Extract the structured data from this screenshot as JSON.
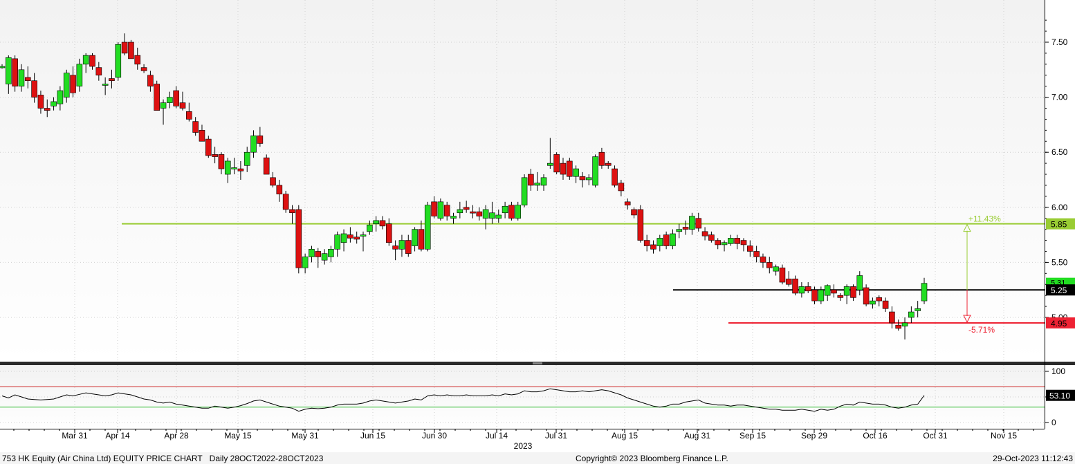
{
  "colors": {
    "up": "#22dd22",
    "down": "#dd1111",
    "resistance": "#99cc33",
    "support": "#ee2233",
    "last": "#000000",
    "rsi_line": "#000000",
    "rsi_upper": "#cc2222",
    "rsi_lower": "#33bb33",
    "gradient_top": "#f2f2f2",
    "gradient_bottom": "#ffffff"
  },
  "chart_data": [
    {
      "type": "candlestick",
      "title": "753 HK Equity (Air China Ltd) EQUITY PRICE CHART",
      "period": "Daily 28OCT2022-28OCT2023",
      "x_axis": {
        "ticks": [
          "Mar 31",
          "Apr 14",
          "Apr 28",
          "May 15",
          "May 31",
          "Jun 15",
          "Jun 30",
          "Jul 14",
          "Jul 31",
          "Aug 15",
          "Aug 31",
          "Sep 15",
          "Sep 29",
          "Oct 16",
          "Oct 31",
          "Nov 15"
        ],
        "year_label": "2023"
      },
      "y_axis": {
        "ylim": [
          4.7,
          7.85
        ],
        "ticks": [
          "7.50",
          "7.00",
          "6.50",
          "6.00",
          "5.50",
          "5.00"
        ]
      },
      "candles": [
        [
          7.28,
          7.3,
          7.26,
          7.28
        ],
        [
          7.12,
          7.38,
          7.03,
          7.36
        ],
        [
          7.35,
          7.38,
          7.05,
          7.1
        ],
        [
          7.1,
          7.3,
          7.05,
          7.25
        ],
        [
          7.18,
          7.28,
          7.08,
          7.15
        ],
        [
          7.15,
          7.22,
          6.95,
          7.0
        ],
        [
          7.02,
          7.06,
          6.85,
          6.9
        ],
        [
          6.9,
          6.98,
          6.82,
          6.88
        ],
        [
          6.92,
          7.0,
          6.88,
          6.96
        ],
        [
          6.94,
          7.1,
          6.88,
          7.06
        ],
        [
          7.0,
          7.25,
          6.95,
          7.22
        ],
        [
          7.2,
          7.28,
          7.0,
          7.04
        ],
        [
          7.1,
          7.35,
          7.05,
          7.3
        ],
        [
          7.3,
          7.4,
          7.22,
          7.38
        ],
        [
          7.38,
          7.4,
          7.25,
          7.28
        ],
        [
          7.27,
          7.32,
          7.15,
          7.2
        ],
        [
          7.12,
          7.18,
          7.02,
          7.12
        ],
        [
          7.17,
          7.25,
          7.08,
          7.15
        ],
        [
          7.18,
          7.5,
          7.15,
          7.48
        ],
        [
          7.5,
          7.58,
          7.38,
          7.4
        ],
        [
          7.5,
          7.52,
          7.35,
          7.35
        ],
        [
          7.38,
          7.45,
          7.25,
          7.3
        ],
        [
          7.27,
          7.3,
          7.22,
          7.24
        ],
        [
          7.2,
          7.24,
          7.05,
          7.1
        ],
        [
          7.12,
          7.15,
          6.88,
          6.88
        ],
        [
          6.9,
          6.98,
          6.75,
          6.95
        ],
        [
          6.95,
          7.05,
          6.9,
          7.0
        ],
        [
          7.06,
          7.1,
          6.9,
          6.92
        ],
        [
          6.95,
          7.05,
          6.88,
          6.9
        ],
        [
          6.87,
          6.95,
          6.78,
          6.8
        ],
        [
          6.78,
          6.82,
          6.65,
          6.68
        ],
        [
          6.7,
          6.75,
          6.6,
          6.6
        ],
        [
          6.62,
          6.65,
          6.45,
          6.47
        ],
        [
          6.48,
          6.55,
          6.4,
          6.46
        ],
        [
          6.48,
          6.5,
          6.3,
          6.35
        ],
        [
          6.3,
          6.45,
          6.22,
          6.42
        ],
        [
          6.36,
          6.45,
          6.3,
          6.36
        ],
        [
          6.35,
          6.42,
          6.25,
          6.33
        ],
        [
          6.38,
          6.55,
          6.32,
          6.5
        ],
        [
          6.5,
          6.7,
          6.45,
          6.65
        ],
        [
          6.65,
          6.73,
          6.55,
          6.58
        ],
        [
          6.45,
          6.48,
          6.3,
          6.3
        ],
        [
          6.27,
          6.32,
          6.18,
          6.2
        ],
        [
          6.2,
          6.25,
          6.05,
          6.12
        ],
        [
          6.12,
          6.15,
          5.95,
          5.98
        ],
        [
          5.98,
          6.02,
          5.85,
          5.95
        ],
        [
          5.98,
          6.02,
          5.4,
          5.45
        ],
        [
          5.45,
          5.58,
          5.4,
          5.55
        ],
        [
          5.55,
          5.65,
          5.5,
          5.62
        ],
        [
          5.6,
          5.63,
          5.45,
          5.55
        ],
        [
          5.52,
          5.62,
          5.48,
          5.58
        ],
        [
          5.55,
          5.65,
          5.5,
          5.62
        ],
        [
          5.62,
          5.78,
          5.55,
          5.75
        ],
        [
          5.68,
          5.8,
          5.6,
          5.76
        ],
        [
          5.75,
          5.82,
          5.68,
          5.72
        ],
        [
          5.73,
          5.78,
          5.67,
          5.71
        ],
        [
          5.75,
          5.78,
          5.6,
          5.75
        ],
        [
          5.78,
          5.88,
          5.75,
          5.84
        ],
        [
          5.85,
          5.92,
          5.78,
          5.88
        ],
        [
          5.88,
          5.92,
          5.8,
          5.83
        ],
        [
          5.85,
          5.9,
          5.65,
          5.68
        ],
        [
          5.65,
          5.7,
          5.52,
          5.62
        ],
        [
          5.62,
          5.75,
          5.55,
          5.7
        ],
        [
          5.7,
          5.75,
          5.55,
          5.58
        ],
        [
          5.65,
          5.82,
          5.6,
          5.8
        ],
        [
          5.8,
          5.88,
          5.6,
          5.62
        ],
        [
          5.62,
          6.05,
          5.6,
          6.02
        ],
        [
          6.05,
          6.1,
          5.9,
          5.92
        ],
        [
          5.9,
          6.08,
          5.88,
          6.05
        ],
        [
          6.02,
          6.05,
          5.88,
          5.92
        ],
        [
          5.9,
          5.95,
          5.85,
          5.92
        ],
        [
          5.95,
          6.05,
          5.9,
          5.98
        ],
        [
          6.0,
          6.06,
          5.95,
          5.98
        ],
        [
          5.96,
          6.02,
          5.9,
          5.95
        ],
        [
          5.96,
          6.0,
          5.88,
          5.92
        ],
        [
          5.9,
          6.02,
          5.8,
          5.98
        ],
        [
          5.9,
          6.05,
          5.85,
          5.95
        ],
        [
          5.9,
          5.98,
          5.86,
          5.93
        ],
        [
          5.95,
          6.05,
          5.9,
          6.01
        ],
        [
          6.02,
          6.05,
          5.88,
          5.9
        ],
        [
          5.9,
          6.05,
          5.88,
          6.02
        ],
        [
          6.02,
          6.3,
          6.0,
          6.27
        ],
        [
          6.3,
          6.35,
          6.15,
          6.2
        ],
        [
          6.2,
          6.32,
          6.15,
          6.22
        ],
        [
          6.2,
          6.3,
          6.15,
          6.27
        ],
        [
          6.38,
          6.63,
          6.35,
          6.4
        ],
        [
          6.48,
          6.5,
          6.3,
          6.32
        ],
        [
          6.4,
          6.45,
          6.25,
          6.3
        ],
        [
          6.42,
          6.45,
          6.25,
          6.28
        ],
        [
          6.28,
          6.38,
          6.22,
          6.35
        ],
        [
          6.28,
          6.32,
          6.18,
          6.25
        ],
        [
          6.25,
          6.3,
          6.2,
          6.27
        ],
        [
          6.2,
          6.48,
          6.18,
          6.46
        ],
        [
          6.5,
          6.54,
          6.35,
          6.38
        ],
        [
          6.4,
          6.42,
          6.35,
          6.38
        ],
        [
          6.35,
          6.38,
          6.18,
          6.2
        ],
        [
          6.22,
          6.25,
          6.1,
          6.15
        ],
        [
          6.05,
          6.08,
          5.98,
          6.02
        ],
        [
          5.98,
          6.0,
          5.9,
          5.93
        ],
        [
          5.98,
          6.02,
          5.68,
          5.7
        ],
        [
          5.7,
          5.75,
          5.6,
          5.65
        ],
        [
          5.66,
          5.7,
          5.58,
          5.62
        ],
        [
          5.65,
          5.75,
          5.6,
          5.72
        ],
        [
          5.75,
          5.78,
          5.62,
          5.65
        ],
        [
          5.65,
          5.8,
          5.62,
          5.76
        ],
        [
          5.78,
          5.85,
          5.72,
          5.8
        ],
        [
          5.82,
          5.88,
          5.75,
          5.8
        ],
        [
          5.8,
          5.95,
          5.75,
          5.92
        ],
        [
          5.9,
          5.95,
          5.78,
          5.81
        ],
        [
          5.78,
          5.82,
          5.7,
          5.74
        ],
        [
          5.75,
          5.78,
          5.68,
          5.7
        ],
        [
          5.7,
          5.72,
          5.62,
          5.66
        ],
        [
          5.66,
          5.7,
          5.6,
          5.68
        ],
        [
          5.67,
          5.75,
          5.65,
          5.72
        ],
        [
          5.72,
          5.75,
          5.62,
          5.67
        ],
        [
          5.7,
          5.72,
          5.6,
          5.66
        ],
        [
          5.65,
          5.7,
          5.55,
          5.6
        ],
        [
          5.6,
          5.65,
          5.5,
          5.55
        ],
        [
          5.55,
          5.58,
          5.45,
          5.5
        ],
        [
          5.5,
          5.55,
          5.4,
          5.45
        ],
        [
          5.42,
          5.48,
          5.38,
          5.46
        ],
        [
          5.45,
          5.48,
          5.3,
          5.32
        ],
        [
          5.35,
          5.42,
          5.28,
          5.3
        ],
        [
          5.35,
          5.38,
          5.2,
          5.22
        ],
        [
          5.22,
          5.32,
          5.18,
          5.28
        ],
        [
          5.28,
          5.32,
          5.22,
          5.24
        ],
        [
          5.25,
          5.28,
          5.12,
          5.15
        ],
        [
          5.15,
          5.28,
          5.12,
          5.25
        ],
        [
          5.2,
          5.3,
          5.15,
          5.29
        ],
        [
          5.25,
          5.3,
          5.18,
          5.22
        ],
        [
          5.2,
          5.22,
          5.15,
          5.18
        ],
        [
          5.2,
          5.3,
          5.12,
          5.28
        ],
        [
          5.28,
          5.3,
          5.15,
          5.18
        ],
        [
          5.25,
          5.42,
          5.2,
          5.38
        ],
        [
          5.27,
          5.3,
          5.1,
          5.12
        ],
        [
          5.12,
          5.18,
          5.08,
          5.15
        ],
        [
          5.18,
          5.2,
          5.1,
          5.15
        ],
        [
          5.15,
          5.18,
          5.05,
          5.08
        ],
        [
          5.05,
          5.1,
          4.9,
          4.95
        ],
        [
          4.93,
          4.98,
          4.88,
          4.9
        ],
        [
          4.92,
          5.0,
          4.8,
          4.95
        ],
        [
          5.0,
          5.1,
          4.95,
          5.05
        ],
        [
          5.06,
          5.15,
          5.0,
          5.08
        ],
        [
          5.15,
          5.36,
          5.12,
          5.31
        ]
      ],
      "reference_lines": [
        {
          "label": "5.85",
          "value": 5.85,
          "role": "resistance",
          "pct_label": "+11.43%"
        },
        {
          "label": "5.25",
          "value": 5.25,
          "role": "last"
        },
        {
          "label": "4.95",
          "value": 4.95,
          "role": "support",
          "pct_label": "-5.71%"
        }
      ],
      "hidden_last_close_label": "5.31"
    },
    {
      "type": "line",
      "name": "rsi",
      "y_axis": {
        "ylim": [
          -10,
          110
        ],
        "ticks": [
          "100",
          "50",
          "0"
        ]
      },
      "reference_levels": [
        70,
        30
      ],
      "last_value_label": "53.10",
      "values": [
        52,
        48,
        54,
        50,
        46,
        45,
        44,
        45,
        46,
        50,
        54,
        52,
        55,
        58,
        56,
        54,
        52,
        54,
        58,
        56,
        54,
        50,
        46,
        44,
        40,
        38,
        40,
        36,
        34,
        32,
        30,
        28,
        28,
        32,
        30,
        28,
        30,
        33,
        37,
        42,
        44,
        40,
        36,
        32,
        30,
        28,
        22,
        26,
        28,
        27,
        28,
        30,
        34,
        36,
        36,
        36,
        38,
        42,
        44,
        42,
        40,
        38,
        40,
        42,
        46,
        44,
        52,
        54,
        52,
        54,
        52,
        52,
        54,
        52,
        52,
        52,
        54,
        52,
        56,
        54,
        56,
        62,
        60,
        60,
        62,
        66,
        64,
        62,
        60,
        60,
        62,
        60,
        62,
        64,
        62,
        58,
        54,
        48,
        44,
        40,
        36,
        32,
        30,
        32,
        36,
        36,
        40,
        42,
        44,
        38,
        36,
        34,
        34,
        32,
        34,
        34,
        32,
        30,
        28,
        26,
        26,
        24,
        24,
        24,
        26,
        24,
        22,
        26,
        24,
        26,
        32,
        36,
        34,
        40,
        38,
        36,
        36,
        34,
        30,
        28,
        30,
        34,
        36,
        53
      ]
    }
  ],
  "footer": {
    "title": "753 HK Equity (Air China Ltd) EQUITY PRICE CHART",
    "period": "Daily 28OCT2022-28OCT2023",
    "copyright": "Copyright© 2023 Bloomberg Finance L.P.",
    "timestamp": "29-Oct-2023 11:12:43"
  }
}
